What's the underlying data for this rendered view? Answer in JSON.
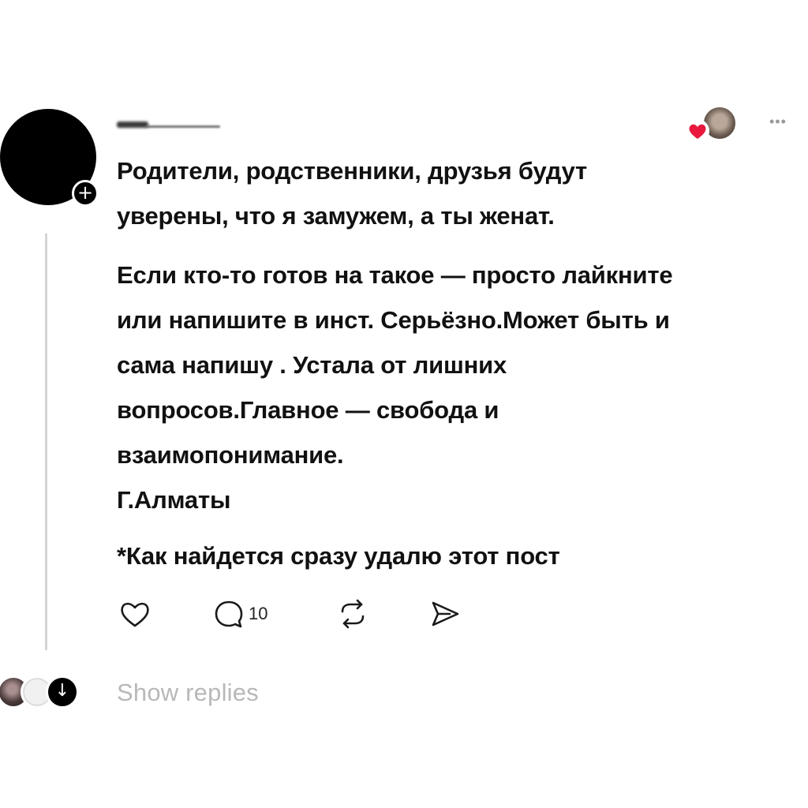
{
  "post": {
    "follow_badge": "+",
    "more_icon": "•••",
    "paragraphs": [
      "Родители, родственники, друзья будут",
      "уверены, что я замужем, а ты женат.",
      "Если кто-то готов на такое — просто лайкните",
      "или напишите в инст. Серьёзно.Может быть и",
      "сама напишу . Устала от лишних",
      "вопросов.Главное — свобода и",
      "взаимопонимание.",
      "Г.Алматы",
      "*Как найдется сразу удалю этот пост"
    ]
  },
  "actions": {
    "like_icon": "heart-outline-icon",
    "comment_icon": "comment-bubble-icon",
    "comment_count": "10",
    "repost_icon": "repost-icon",
    "share_icon": "send-icon"
  },
  "footer": {
    "expand_glyph": "↓",
    "show_replies_label": "Show replies"
  },
  "colors": {
    "text": "#111111",
    "muted": "#b8b8b8",
    "heart": "#e8193c",
    "thread_line": "#d4d4d4"
  }
}
